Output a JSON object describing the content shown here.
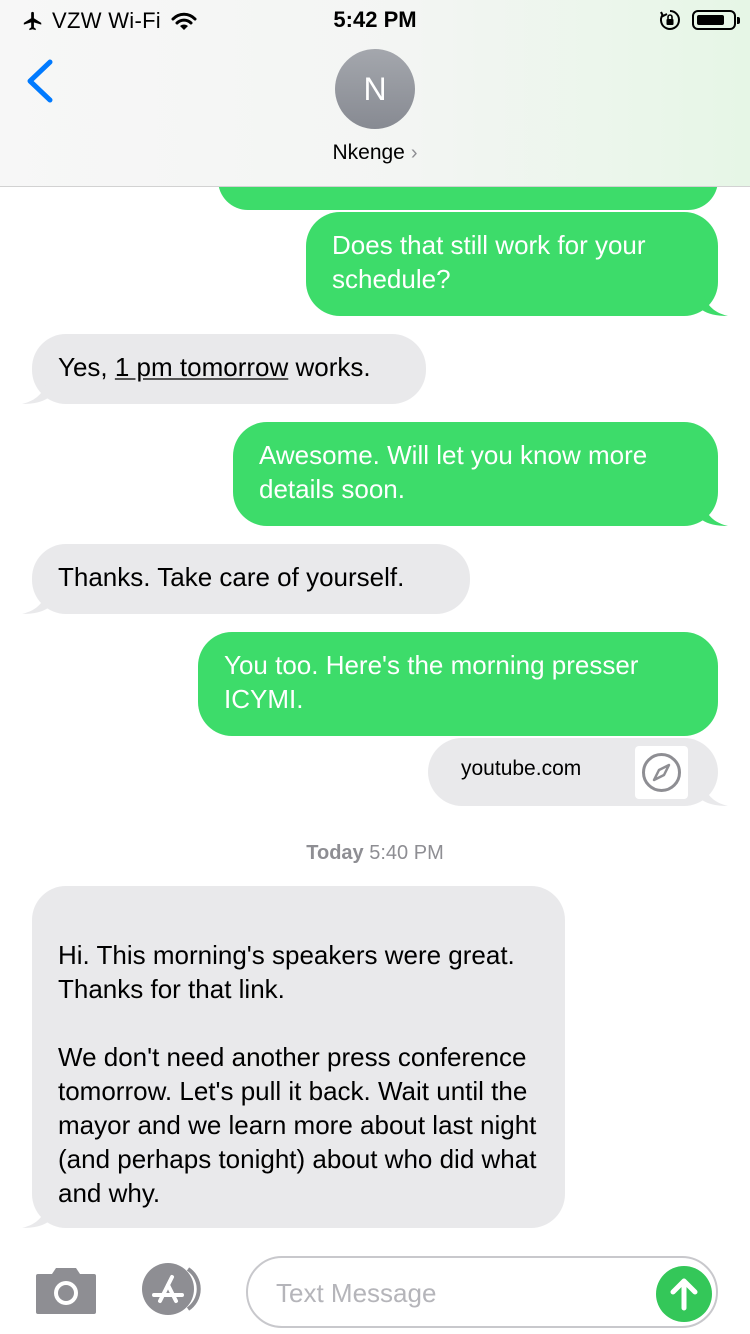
{
  "status_bar": {
    "carrier": "VZW Wi-Fi",
    "time": "5:42 PM",
    "icons": [
      "airplane-icon",
      "wifi-icon",
      "rotation-lock-icon",
      "battery-icon"
    ]
  },
  "header": {
    "avatar_initial": "N",
    "contact_name": "Nkenge",
    "contact_chevron": "›",
    "back_icon": "chevron-left-icon"
  },
  "messages": [
    {
      "type": "sent",
      "text": "Does that still work for your schedule?"
    },
    {
      "type": "received",
      "parts": [
        "Yes, ",
        "1 pm tomorrow",
        " works."
      ]
    },
    {
      "type": "sent",
      "text": "Awesome. Will let you know more details soon."
    },
    {
      "type": "received",
      "text": "Thanks. Take care of yourself."
    },
    {
      "type": "sent",
      "text": "You too. Here's the morning presser ICYMI."
    },
    {
      "type": "link",
      "domain": "youtube.com",
      "icon": "compass-icon"
    },
    {
      "type": "received",
      "text": "Hi. This morning's speakers were great. Thanks for that link.\n\nWe don't need another press conference tomorrow. Let's pull it back. Wait until the mayor and we learn more about last night (and perhaps tonight) about who did what and why."
    }
  ],
  "timestamp": {
    "day": "Today",
    "time": "5:40 PM"
  },
  "input_bar": {
    "placeholder": "Text Message",
    "value": "",
    "icons": [
      "camera-icon",
      "app-store-icon",
      "send-arrow-icon"
    ]
  },
  "colors": {
    "sent_bubble": "#3ddc6a",
    "received_bubble": "#e9e9eb",
    "accent_blue": "#007aff",
    "send_button": "#34c759"
  }
}
